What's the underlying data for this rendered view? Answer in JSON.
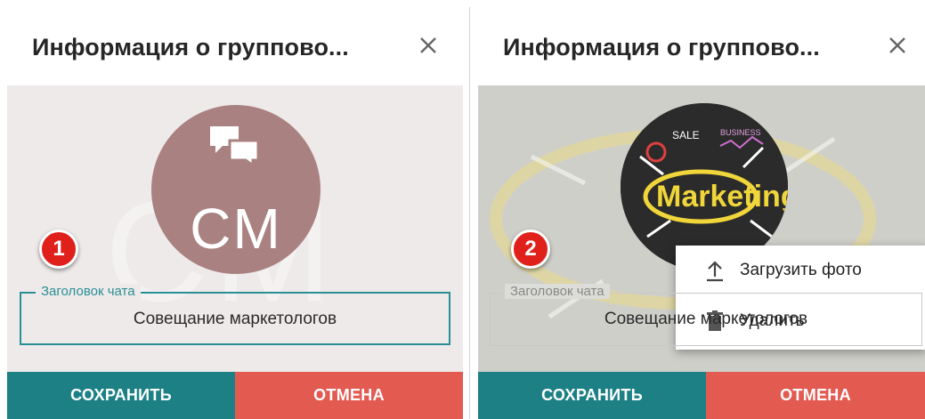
{
  "panel1": {
    "title": "Информация о группово...",
    "avatar_initials": "CM",
    "background_initials": "CM",
    "badge": "1",
    "field_label": "Заголовок чата",
    "field_value": "Совещание маркетологов",
    "save_label": "СОХРАНИТЬ",
    "cancel_label": "ОТМЕНА"
  },
  "panel2": {
    "title": "Информация о группово...",
    "badge": "2",
    "photo_text": "Marketing",
    "photo_labels": [
      "SALE",
      "BUSINESS"
    ],
    "field_label": "Заголовок чата",
    "field_value": "Совещание маркетологов",
    "save_label": "СОХРАНИТЬ",
    "cancel_label": "ОТМЕНА",
    "menu": {
      "upload_label": "Загрузить фото",
      "delete_label": "Удалить"
    }
  },
  "colors": {
    "save": "#1c8085",
    "cancel": "#e35a51",
    "accent": "#2a8f96",
    "avatar": "#a98180",
    "badge": "#e0201b"
  },
  "icons": [
    "close-icon",
    "chat-icon",
    "upload-icon",
    "trash-icon"
  ]
}
